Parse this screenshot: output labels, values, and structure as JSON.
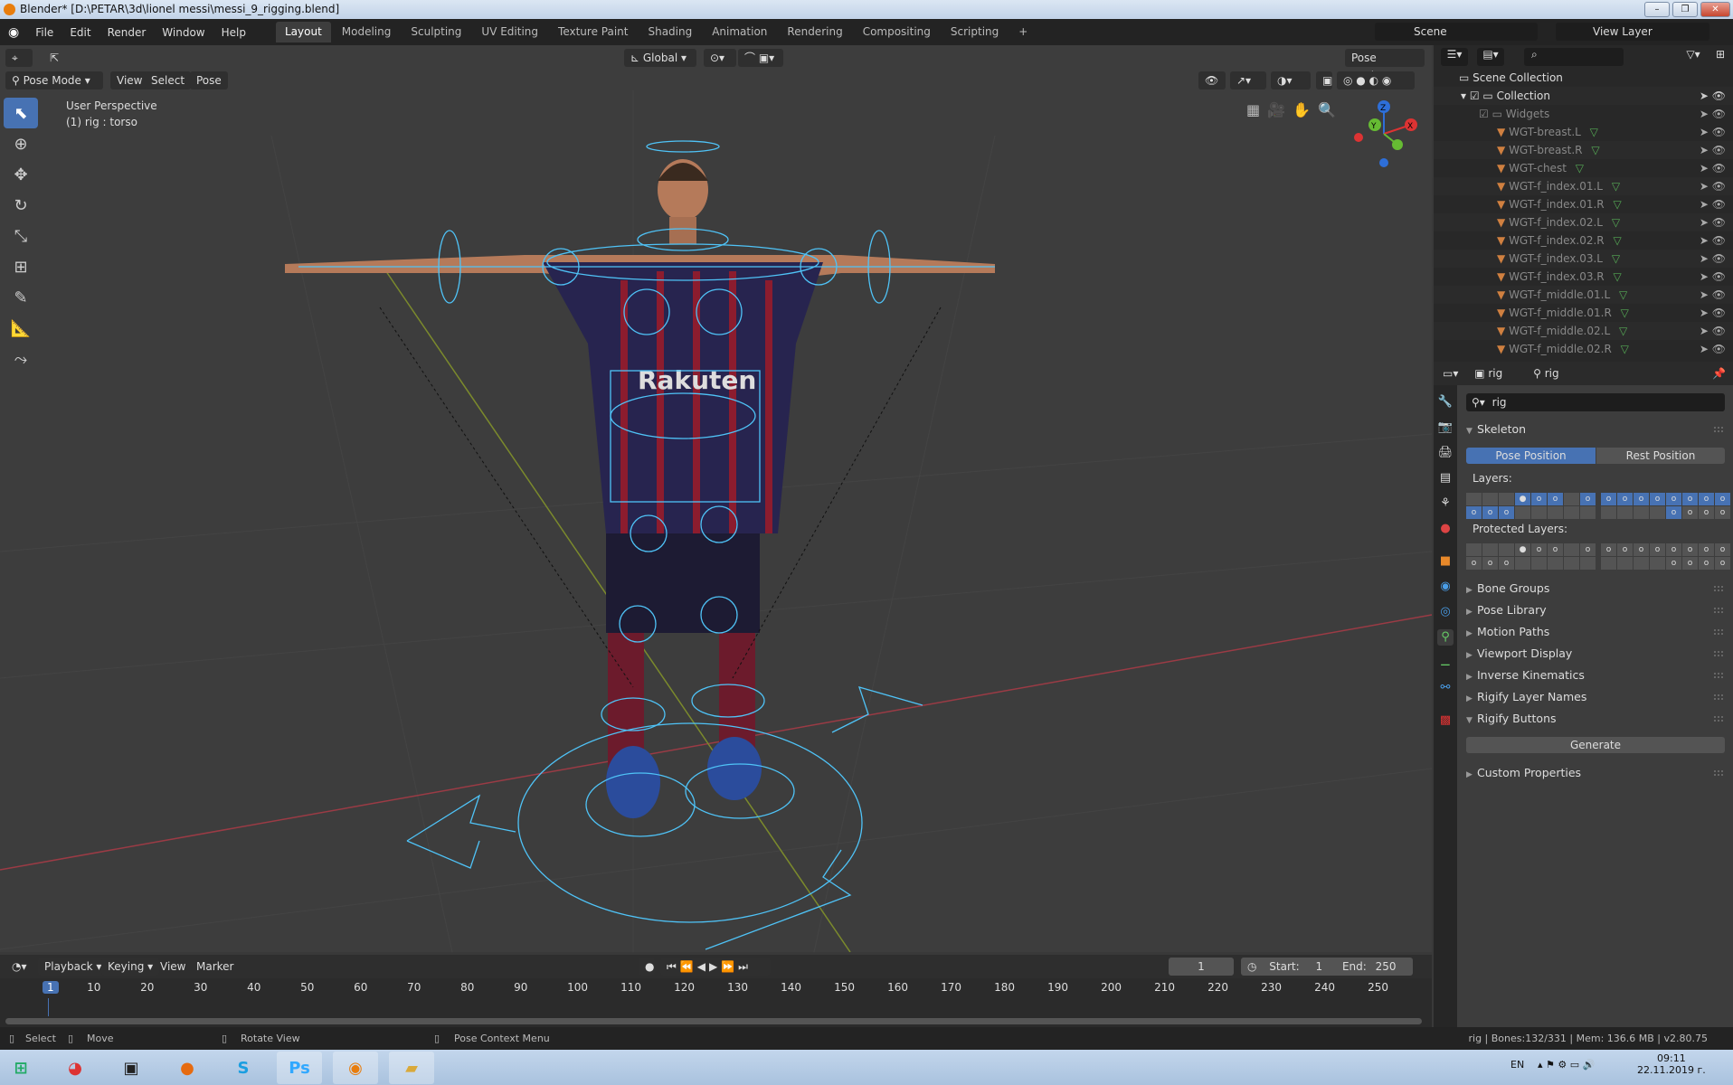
{
  "title": "Blender* [D:\\PETAR\\3d\\lionel messi\\messi_9_rigging.blend]",
  "menu": [
    "File",
    "Edit",
    "Render",
    "Window",
    "Help"
  ],
  "workspaces": [
    "Layout",
    "Modeling",
    "Sculpting",
    "UV Editing",
    "Texture Paint",
    "Shading",
    "Animation",
    "Rendering",
    "Compositing",
    "Scripting",
    "+"
  ],
  "scene": "Scene",
  "view_layer": "View Layer",
  "viewport": {
    "mode": "Pose Mode",
    "menus": [
      "View",
      "Select",
      "Pose"
    ],
    "transform_orientation": "Global",
    "pose_options": "Pose Options",
    "perspective": "User Perspective",
    "selection": "(1) rig : torso",
    "gizmo": {
      "x": "X",
      "y": "Y",
      "z": "Z"
    }
  },
  "outliner": {
    "scene_collection": "Scene Collection",
    "collection": "Collection",
    "widgets": "Widgets",
    "items": [
      "WGT-breast.L",
      "WGT-breast.R",
      "WGT-chest",
      "WGT-f_index.01.L",
      "WGT-f_index.01.R",
      "WGT-f_index.02.L",
      "WGT-f_index.02.R",
      "WGT-f_index.03.L",
      "WGT-f_index.03.R",
      "WGT-f_middle.01.L",
      "WGT-f_middle.01.R",
      "WGT-f_middle.02.L",
      "WGT-f_middle.02.R"
    ]
  },
  "properties": {
    "object": "rig",
    "data": "rig",
    "datablock": "rig",
    "skeleton": "Skeleton",
    "pose_position": "Pose Position",
    "rest_position": "Rest Position",
    "layers_label": "Layers:",
    "protected_label": "Protected Layers:",
    "panels": [
      "Bone Groups",
      "Pose Library",
      "Motion Paths",
      "Viewport Display",
      "Inverse Kinematics",
      "Rigify Layer Names",
      "Rigify Buttons"
    ],
    "generate": "Generate",
    "custom_properties": "Custom Properties"
  },
  "timeline": {
    "menus": [
      "Playback",
      "Keying",
      "View",
      "Marker"
    ],
    "current_frame": "1",
    "start_label": "Start:",
    "start": "1",
    "end_label": "End:",
    "end": "250",
    "ticks": [
      "1",
      "10",
      "20",
      "30",
      "40",
      "50",
      "60",
      "70",
      "80",
      "90",
      "100",
      "110",
      "120",
      "130",
      "140",
      "150",
      "160",
      "170",
      "180",
      "190",
      "200",
      "210",
      "220",
      "230",
      "240",
      "250"
    ]
  },
  "status": {
    "select": "Select",
    "move": "Move",
    "rotate": "Rotate View",
    "context": "Pose Context Menu",
    "info": "rig | Bones:132/331 | Mem: 136.6 MB | v2.80.75"
  },
  "taskbar": {
    "lang": "EN",
    "time": "09:11",
    "date": "22.11.2019 г."
  }
}
